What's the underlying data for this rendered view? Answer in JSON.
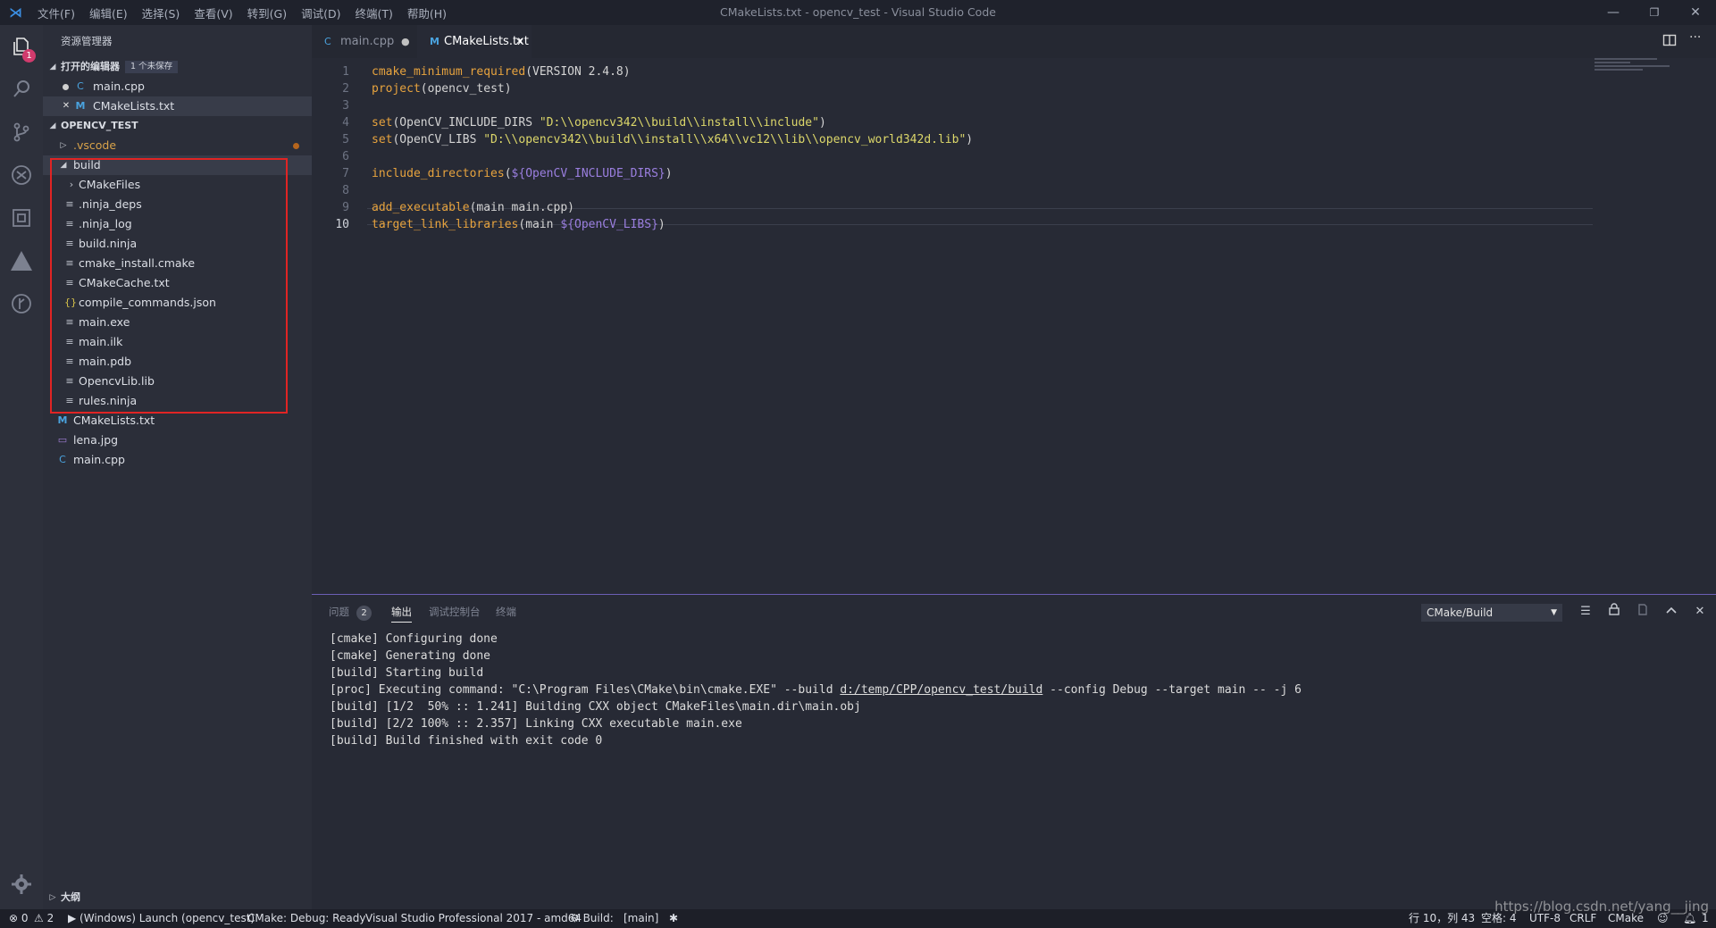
{
  "titlebar": {
    "menus": [
      "文件(F)",
      "编辑(E)",
      "选择(S)",
      "查看(V)",
      "转到(G)",
      "调试(D)",
      "终端(T)",
      "帮助(H)"
    ],
    "window_title": "CMakeLists.txt - opencv_test - Visual Studio Code",
    "minimize": "—",
    "restore": "❐",
    "close": "✕"
  },
  "activity_bar": {
    "explorer_badge": "1",
    "icons": [
      "explorer-icon",
      "search-icon",
      "source-control-icon",
      "debug-icon",
      "extensions-icon",
      "cmake-icon",
      "gitlens-icon",
      "gear-icon"
    ]
  },
  "sidebar": {
    "title": "资源管理器",
    "open_editors": {
      "header": "打开的编辑器",
      "unsaved_tag": "1 个未保存",
      "items": [
        {
          "label": "main.cpp",
          "icon": "C"
        },
        {
          "label": "CMakeLists.txt",
          "icon": "M",
          "close": "✕"
        }
      ]
    },
    "project": {
      "header": "OPENCV_TEST",
      "vscode": ".vscode",
      "build": "build",
      "build_children": [
        {
          "label": "CMakeFiles",
          "icon": "›"
        },
        {
          "label": ".ninja_deps",
          "icon": "≡"
        },
        {
          "label": ".ninja_log",
          "icon": "≡"
        },
        {
          "label": "build.ninja",
          "icon": "≡"
        },
        {
          "label": "cmake_install.cmake",
          "icon": "≡"
        },
        {
          "label": "CMakeCache.txt",
          "icon": "≡"
        },
        {
          "label": "compile_commands.json",
          "icon": "{}"
        },
        {
          "label": "main.exe",
          "icon": "≡"
        },
        {
          "label": "main.ilk",
          "icon": "≡"
        },
        {
          "label": "main.pdb",
          "icon": "≡"
        },
        {
          "label": "OpencvLib.lib",
          "icon": "≡"
        },
        {
          "label": "rules.ninja",
          "icon": "≡"
        }
      ],
      "root_files": [
        {
          "label": "CMakeLists.txt",
          "icon": "M"
        },
        {
          "label": "lena.jpg",
          "icon": "▭"
        },
        {
          "label": "main.cpp",
          "icon": "C"
        }
      ]
    },
    "outline": "大纲"
  },
  "tabs": [
    {
      "label": "main.cpp",
      "icon": "C",
      "dirty": "●"
    },
    {
      "label": "CMakeLists.txt",
      "icon": "M",
      "close": "✕"
    }
  ],
  "editor": {
    "lines": [
      {
        "n": "1",
        "parts": [
          [
            "kw",
            "cmake_minimum_required"
          ],
          [
            "tx",
            "(VERSION 2.4.8)"
          ]
        ]
      },
      {
        "n": "2",
        "parts": [
          [
            "kw",
            "project"
          ],
          [
            "tx",
            "(opencv_test)"
          ]
        ]
      },
      {
        "n": "3",
        "parts": []
      },
      {
        "n": "4",
        "parts": [
          [
            "kw",
            "set"
          ],
          [
            "tx",
            "(OpenCV_INCLUDE_DIRS "
          ],
          [
            "str",
            "\"D:\\\\opencv342\\\\build\\\\install\\\\include\""
          ],
          [
            "tx",
            ")"
          ]
        ]
      },
      {
        "n": "5",
        "parts": [
          [
            "kw",
            "set"
          ],
          [
            "tx",
            "(OpenCV_LIBS "
          ],
          [
            "str",
            "\"D:\\\\opencv342\\\\build\\\\install\\\\x64\\\\vc12\\\\lib\\\\opencv_world342d.lib\""
          ],
          [
            "tx",
            ")"
          ]
        ]
      },
      {
        "n": "6",
        "parts": []
      },
      {
        "n": "7",
        "parts": [
          [
            "kw",
            "include_directories"
          ],
          [
            "tx",
            "("
          ],
          [
            "var",
            "${OpenCV_INCLUDE_DIRS}"
          ],
          [
            "tx",
            ")"
          ]
        ]
      },
      {
        "n": "8",
        "parts": []
      },
      {
        "n": "9",
        "parts": [
          [
            "kw",
            "add_executable"
          ],
          [
            "tx",
            "(main main.cpp)"
          ]
        ]
      },
      {
        "n": "10",
        "parts": [
          [
            "kw",
            "target_link_libraries"
          ],
          [
            "tx",
            "(main "
          ],
          [
            "var",
            "${OpenCV_LIBS}"
          ],
          [
            "tx",
            ")"
          ]
        ]
      }
    ]
  },
  "panel": {
    "tabs": [
      {
        "label": "问题",
        "badge": "2"
      },
      {
        "label": "输出"
      },
      {
        "label": "调试控制台"
      },
      {
        "label": "终端"
      }
    ],
    "output_channel": "CMake/Build",
    "output_lines": [
      "[cmake] Configuring done",
      "[cmake] Generating done",
      "[build] Starting build",
      "[proc] Executing command: \"C:\\Program Files\\CMake\\bin\\cmake.EXE\" --build d:/temp/CPP/opencv_test/build --config Debug --target main -- -j 6",
      "[build] [1/2  50% :: 1.241] Building CXX object CMakeFiles\\main.dir\\main.obj",
      "[build] [2/2 100% :: 2.357] Linking CXX executable main.exe",
      "[build] Build finished with exit code 0"
    ],
    "output_line4": {
      "before": "[proc] Executing command: \"C:\\Program Files\\CMake\\bin\\cmake.EXE\" --build ",
      "link": "d:/temp/CPP/opencv_test/build",
      "after": " --config Debug --target main -- -j 6"
    }
  },
  "statusbar": {
    "errors": "⊗ 0",
    "warnings": "⚠ 2",
    "launch": "▶ (Windows) Launch (opencv_test)",
    "cmake_status": "CMake: Debug: Ready",
    "kit": "Visual Studio Professional 2017 - amd64",
    "build": "⚙ Build:",
    "target": "[main]",
    "debug_icon": "✱",
    "position": "行 10，列 43",
    "spaces": "空格: 4",
    "encoding": "UTF-8",
    "eol": "CRLF",
    "language": "CMake",
    "bell": "1"
  },
  "watermark": "https://blog.csdn.net/yang__jing"
}
